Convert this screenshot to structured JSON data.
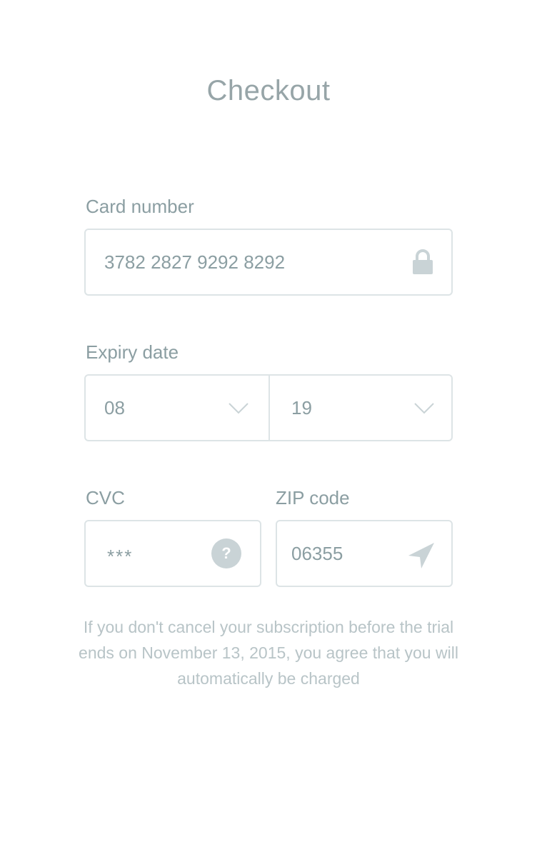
{
  "page": {
    "title": "Checkout"
  },
  "card": {
    "label": "Card number",
    "value": "3782 2827 9292 8292",
    "icon": "lock-icon"
  },
  "expiry": {
    "label": "Expiry date",
    "month": "08",
    "year": "19",
    "icon": "chevron-down-icon"
  },
  "cvc": {
    "label": "CVC",
    "value": "***",
    "help_glyph": "?",
    "icon": "help-icon"
  },
  "zip": {
    "label": "ZIP code",
    "value": "06355",
    "icon": "location-arrow-icon"
  },
  "disclaimer": {
    "text": "If you don't cancel your subscription before the trial ends on November 13, 2015, you agree that you will automatically be charged"
  },
  "colors": {
    "text": "#8b9ea2",
    "border": "#dde4e6",
    "icon": "#c9d3d6",
    "muted_text": "#b8c4c7"
  }
}
